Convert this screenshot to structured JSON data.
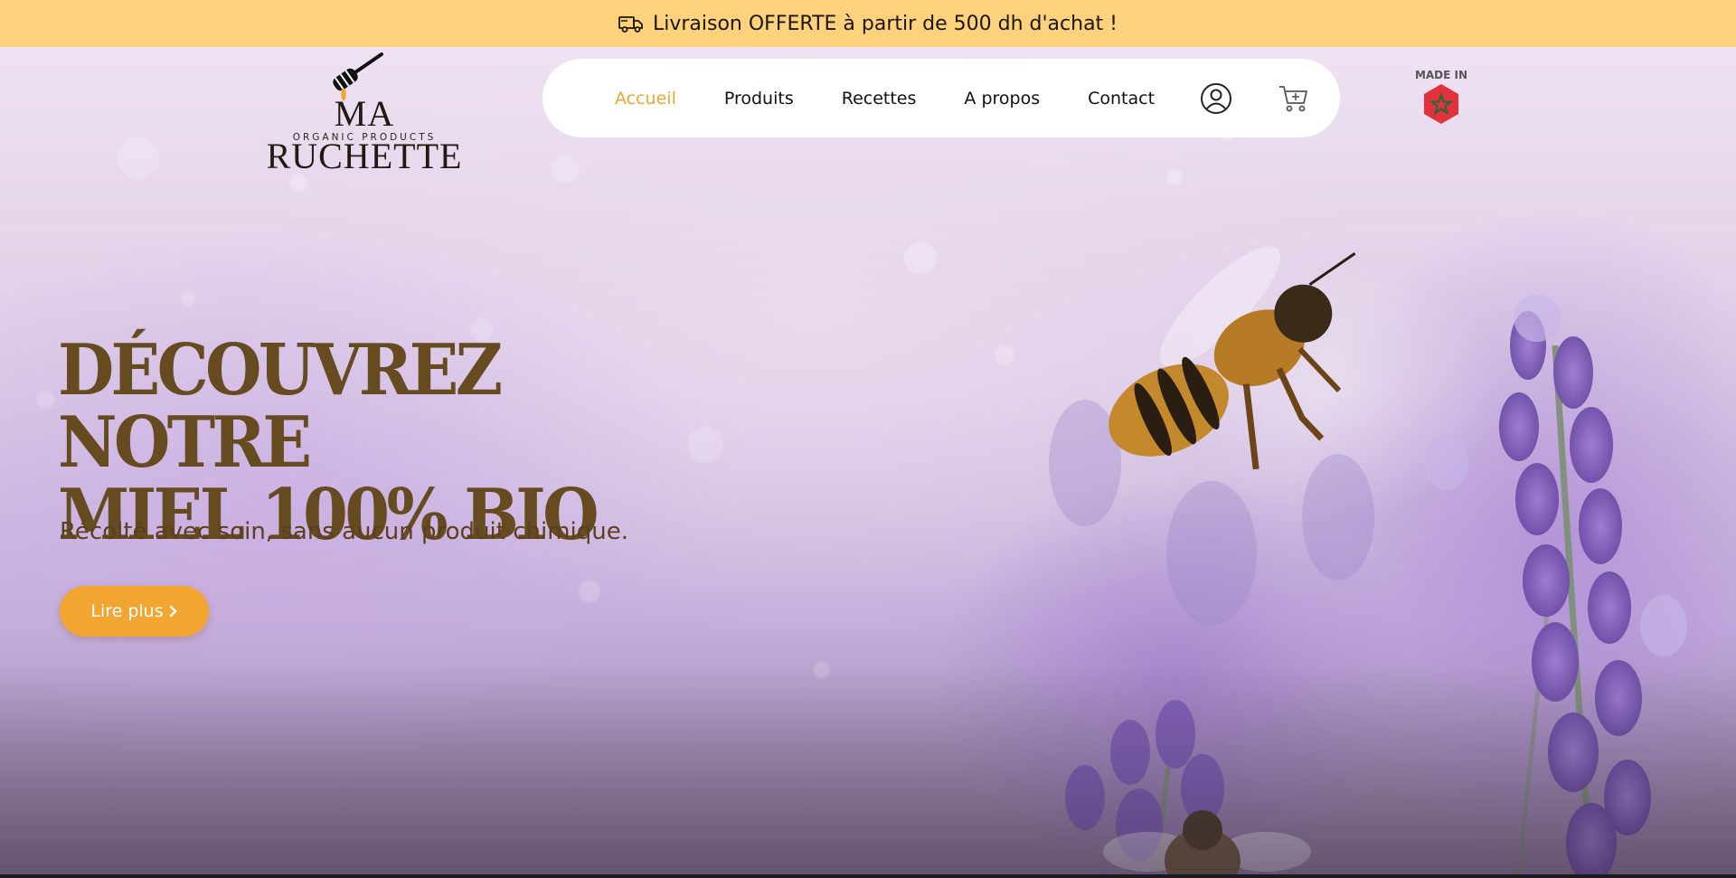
{
  "announcement": {
    "icon": "delivery-truck-icon",
    "text": "Livraison OFFERTE à partir de 500 dh d'achat !"
  },
  "logo": {
    "brand": "MA RUCHETTE",
    "tagline": "ORGANIC PRODUCTS",
    "icon": "honey-dipper-icon"
  },
  "nav": {
    "items": [
      {
        "label": "Accueil",
        "active": true
      },
      {
        "label": "Produits",
        "active": false
      },
      {
        "label": "Recettes",
        "active": false
      },
      {
        "label": "A propos",
        "active": false
      },
      {
        "label": "Contact",
        "active": false
      }
    ],
    "user_icon": "user-icon",
    "cart_icon": "cart-icon"
  },
  "made_in": {
    "label": "MADE IN",
    "icon": "morocco-flag-hexagon-icon"
  },
  "hero": {
    "headline_line1": "DÉCOUVREZ NOTRE",
    "headline_line2": "MIEL 100% BIO",
    "subtitle": "Récolté avec soin, sans aucun produit chimique.",
    "cta_label": "Lire plus",
    "cta_icon": "chevron-right-icon"
  },
  "colors": {
    "announcement_bg": "#fdd27c",
    "accent": "#f2a530",
    "headline": "#654b1f",
    "active_nav": "#f0a531"
  }
}
